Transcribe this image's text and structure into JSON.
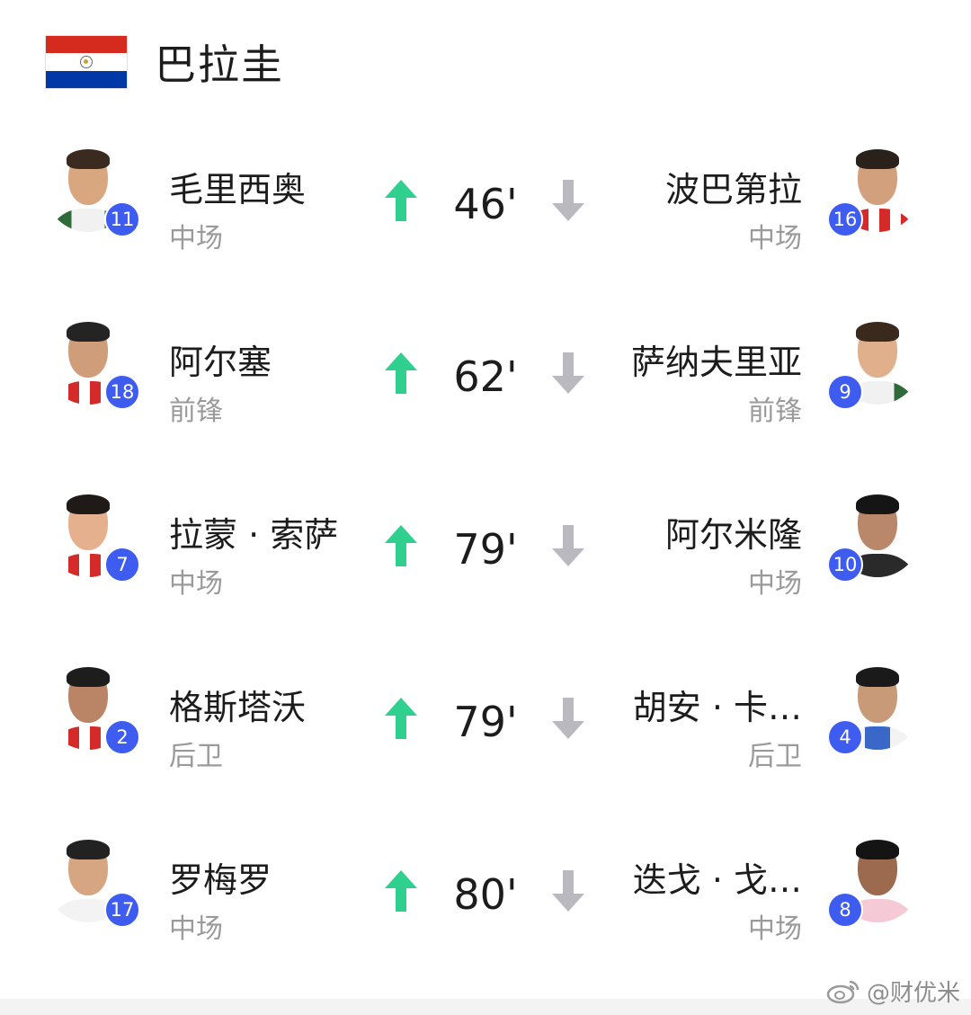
{
  "team": {
    "name": "巴拉圭",
    "flag_colors": [
      "#d52b1e",
      "#ffffff",
      "#0038a8"
    ]
  },
  "colors": {
    "badge": "#3e5df0",
    "arrow_in": "#2fcf8f",
    "arrow_out": "#b9b9bf",
    "position_text": "#9a9a9a"
  },
  "substitutions": [
    {
      "minute": "46'",
      "in": {
        "name": "毛里西奥",
        "position": "中场",
        "number": "11"
      },
      "out": {
        "name": "波巴第拉",
        "position": "中场",
        "number": "16"
      }
    },
    {
      "minute": "62'",
      "in": {
        "name": "阿尔塞",
        "position": "前锋",
        "number": "18"
      },
      "out": {
        "name": "萨纳夫里亚",
        "position": "前锋",
        "number": "9"
      }
    },
    {
      "minute": "79'",
      "in": {
        "name": "拉蒙 · 索萨",
        "position": "中场",
        "number": "7"
      },
      "out": {
        "name": "阿尔米隆",
        "position": "中场",
        "number": "10"
      }
    },
    {
      "minute": "79'",
      "in": {
        "name": "格斯塔沃",
        "position": "后卫",
        "number": "2"
      },
      "out": {
        "name": "胡安 · 卡…",
        "position": "后卫",
        "number": "4"
      }
    },
    {
      "minute": "80'",
      "in": {
        "name": "罗梅罗",
        "position": "中场",
        "number": "17"
      },
      "out": {
        "name": "迭戈 · 戈…",
        "position": "中场",
        "number": "8"
      }
    }
  ],
  "watermark": {
    "text": "@财优米"
  }
}
